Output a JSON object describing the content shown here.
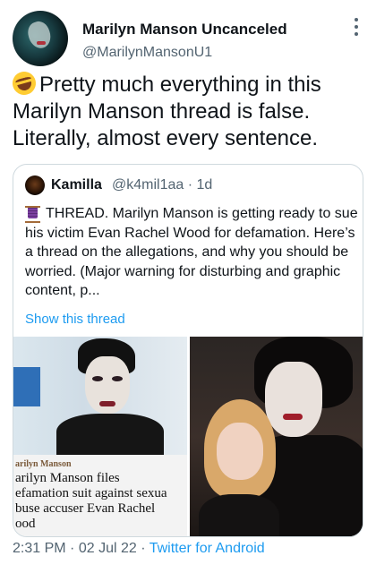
{
  "tweet": {
    "author_name": "Marilyn Manson Uncanceled",
    "author_handle": "@MarilynMansonU1",
    "text": "Pretty much everything in this Marilyn Manson thread is false. Literally, almost every sentence.",
    "emoji_icon": "rolling-on-floor-laughing-emoji"
  },
  "quote": {
    "author_name": "Kamilla",
    "author_handle": "@k4mil1aa",
    "separator": "·",
    "age": "1d",
    "thread_icon": "thread-spool-icon",
    "text": "THREAD. Marilyn Manson is getting ready to sue his victim Evan Rachel Wood for defamation. Here’s a thread on the allegations, and why you should be worried. (Major warning for disturbing and graphic content, p...",
    "show_thread_label": "Show this thread",
    "link_color": "#1d9bf0"
  },
  "media": {
    "left_caption_kicker": "arilyn Manson",
    "left_caption_headline": "arilyn Manson files\nefamation suit against sexua\nbuse accuser Evan Rachel\nood"
  },
  "footer": {
    "time": "2:31 PM",
    "dot1": "·",
    "date": "02 Jul 22",
    "dot2": "·",
    "source": "Twitter for Android"
  }
}
